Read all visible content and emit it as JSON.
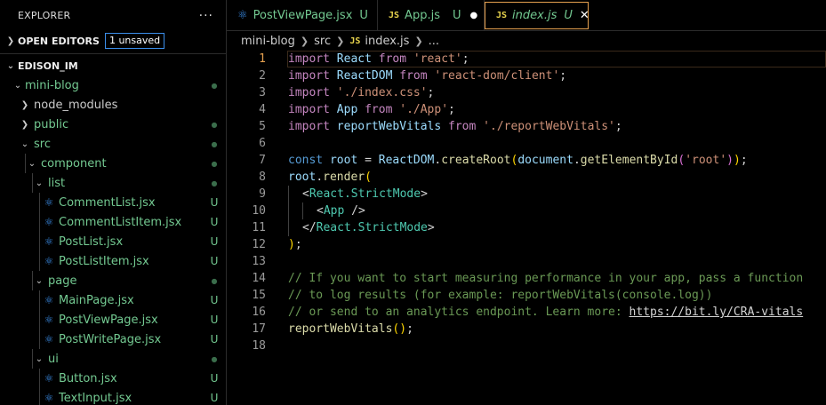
{
  "explorer": {
    "title": "EXPLORER",
    "more": "···",
    "open_editors": "OPEN EDITORS",
    "unsaved": "1 unsaved",
    "workspace": "EDISON_IM",
    "tree": [
      {
        "label": "mini-blog",
        "status": "●"
      },
      {
        "label": "node_modules",
        "status": ""
      },
      {
        "label": "public",
        "status": "●"
      },
      {
        "label": "src",
        "status": "●"
      },
      {
        "label": "component",
        "status": "●"
      },
      {
        "label": "list",
        "status": "●"
      },
      {
        "label": "CommentList.jsx",
        "status": "U"
      },
      {
        "label": "CommentListItem.jsx",
        "status": "U"
      },
      {
        "label": "PostList.jsx",
        "status": "U"
      },
      {
        "label": "PostListItem.jsx",
        "status": "U"
      },
      {
        "label": "page",
        "status": "●"
      },
      {
        "label": "MainPage.jsx",
        "status": "U"
      },
      {
        "label": "PostViewPage.jsx",
        "status": "U"
      },
      {
        "label": "PostWritePage.jsx",
        "status": "U"
      },
      {
        "label": "ui",
        "status": "●"
      },
      {
        "label": "Button.jsx",
        "status": "U"
      },
      {
        "label": "TextInput.jsx",
        "status": "U"
      }
    ]
  },
  "tabs": [
    {
      "label": "PostViewPage.jsx",
      "status": "U"
    },
    {
      "label": "App.js",
      "status": "U",
      "dirty": "●"
    },
    {
      "label": "index.js",
      "status": "U",
      "close": "✕"
    }
  ],
  "icons": {
    "js": "JS",
    "react": "⚛"
  },
  "breadcrumb": [
    "mini-blog",
    "src",
    "index.js",
    "..."
  ],
  "line_numbers": [
    "1",
    "2",
    "3",
    "4",
    "5",
    "6",
    "7",
    "8",
    "9",
    "10",
    "11",
    "12",
    "13",
    "14",
    "15",
    "16",
    "17",
    "18"
  ],
  "code": {
    "l1": [
      "import",
      " ",
      "React",
      " ",
      "from",
      " ",
      "'react'",
      ";"
    ],
    "l2": [
      "import",
      " ",
      "ReactDOM",
      " ",
      "from",
      " ",
      "'react-dom/client'",
      ";"
    ],
    "l3": [
      "import",
      " ",
      "'./index.css'",
      ";"
    ],
    "l4": [
      "import",
      " ",
      "App",
      " ",
      "from",
      " ",
      "'./App'",
      ";"
    ],
    "l5": [
      "import",
      " ",
      "reportWebVitals",
      " ",
      "from",
      " ",
      "'./reportWebVitals'",
      ";"
    ],
    "l7": [
      "const",
      " ",
      "root",
      " = ",
      "ReactDOM",
      ".",
      "createRoot",
      "(",
      "document",
      ".",
      "getElementById",
      "(",
      "'root'",
      ")",
      ")",
      ";"
    ],
    "l8": [
      "root",
      ".",
      "render",
      "("
    ],
    "l9": [
      "<",
      "React.StrictMode",
      ">"
    ],
    "l10": [
      "<",
      "App",
      " />"
    ],
    "l11": [
      "</",
      "React.StrictMode",
      ">"
    ],
    "l12": [
      ")",
      ";"
    ],
    "l14": "// If you want to start measuring performance in your app, pass a function",
    "l15": "// to log results (for example: reportWebVitals(console.log))",
    "l16a": "// or send to an analytics endpoint. Learn more: ",
    "l16b": "https://bit.ly/CRA-vitals",
    "l17": [
      "reportWebVitals",
      "(",
      ")",
      ";"
    ]
  }
}
